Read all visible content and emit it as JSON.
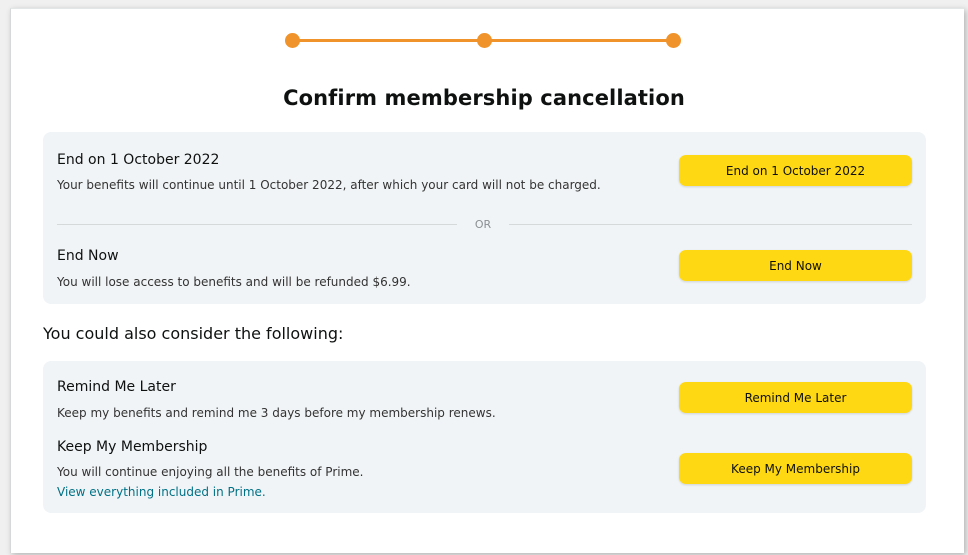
{
  "title": "Confirm membership cancellation",
  "colors": {
    "accent": "#f0932b",
    "button": "#ffd814",
    "panel": "#f1f4f6",
    "link": "#007185"
  },
  "progress": {
    "steps": 3,
    "current": 3
  },
  "primary_options": {
    "end_on_date": {
      "title": "End on 1 October 2022",
      "description": "Your benefits will continue until 1 October 2022, after which your card will not be charged.",
      "button_label": "End on 1 October 2022"
    },
    "divider_text": "OR",
    "end_now": {
      "title": "End Now",
      "description": "You will lose access to benefits and will be refunded $6.99.",
      "button_label": "End Now"
    }
  },
  "consider_heading": "You could also consider the following:",
  "secondary_options": {
    "remind_later": {
      "title": "Remind Me Later",
      "description": "Keep my benefits and remind me 3 days before my membership renews.",
      "button_label": "Remind Me Later"
    },
    "keep_membership": {
      "title": "Keep My Membership",
      "description": "You will continue enjoying all the benefits of Prime.",
      "link": "View everything included in Prime.",
      "button_label": "Keep My Membership"
    }
  }
}
